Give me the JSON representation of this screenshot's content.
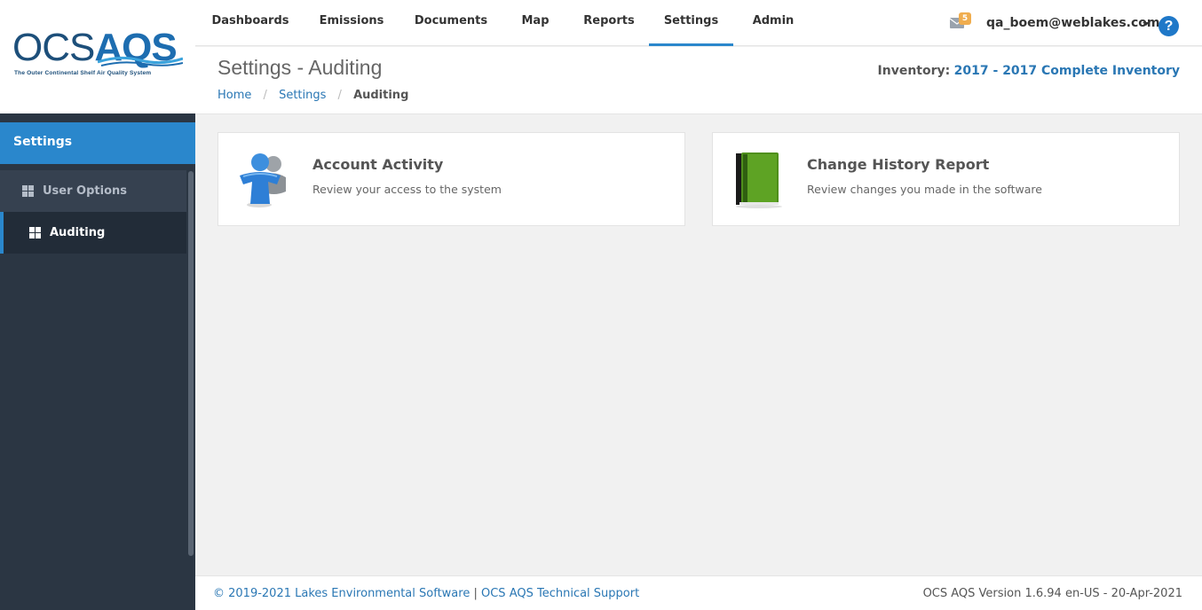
{
  "logo": {
    "ocs": "OCS",
    "aqs": "AQS",
    "tagline": "The Outer Continental Shelf Air Quality System"
  },
  "sidebar": {
    "heading": "Settings",
    "items": [
      {
        "label": "User Options",
        "icon": "grid-icon",
        "active": false
      },
      {
        "label": "Auditing",
        "icon": "grid-icon",
        "active": true
      }
    ]
  },
  "topnav": {
    "tabs": [
      {
        "label": "Dashboards"
      },
      {
        "label": "Emissions"
      },
      {
        "label": "Documents"
      },
      {
        "label": "Map"
      },
      {
        "label": "Reports"
      },
      {
        "label": "Settings",
        "active": true
      },
      {
        "label": "Admin"
      }
    ],
    "mail_count": "5",
    "user_email": "qa_boem@weblakes.com",
    "help_glyph": "?"
  },
  "header": {
    "title": "Settings - Auditing",
    "breadcrumb": {
      "home": "Home",
      "settings": "Settings",
      "current": "Auditing",
      "separator": "/"
    },
    "inventory_label": "Inventory:",
    "inventory_value": "2017 - 2017 Complete Inventory"
  },
  "cards": [
    {
      "title": "Account Activity",
      "description": "Review your access to the system",
      "icon": "users-icon"
    },
    {
      "title": "Change History Report",
      "description": "Review changes you made in the software",
      "icon": "book-icon"
    }
  ],
  "footer": {
    "copyright": "© 2019-2021 Lakes Environmental Software",
    "separator": "|",
    "support": "OCS AQS Technical Support",
    "version": "OCS AQS Version 1.6.94 en-US - 20-Apr-2021"
  },
  "colors": {
    "accent": "#2a87cc",
    "sidebar_bg": "#2b3643",
    "link": "#2a77b4",
    "badge": "#f0ad4e"
  }
}
